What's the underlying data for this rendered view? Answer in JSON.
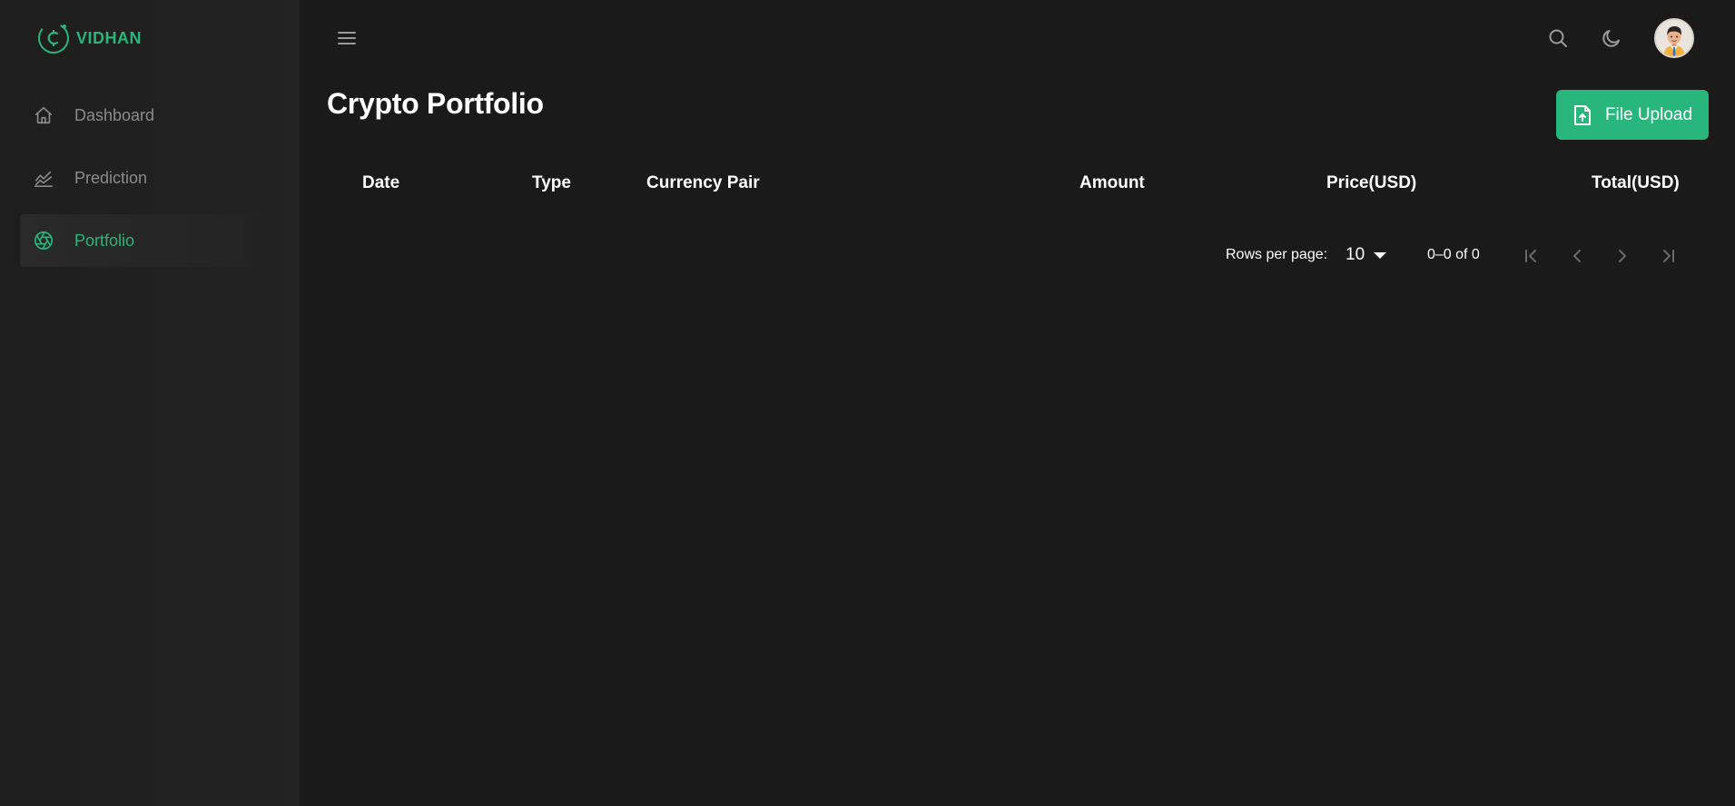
{
  "brand": {
    "name": "VIDHAN",
    "accent": "#28b67c"
  },
  "sidebar": {
    "items": [
      {
        "label": "Dashboard",
        "icon": "home-icon",
        "active": false
      },
      {
        "label": "Prediction",
        "icon": "chart-icon",
        "active": false
      },
      {
        "label": "Portfolio",
        "icon": "aperture-icon",
        "active": true
      }
    ]
  },
  "topbar": {
    "icons": [
      "menu-icon",
      "search-icon",
      "moon-icon",
      "avatar"
    ]
  },
  "main": {
    "title": "Crypto Portfolio",
    "upload_label": "File Upload",
    "columns": [
      "Date",
      "Type",
      "Currency Pair",
      "Amount",
      "Price(USD)",
      "Total(USD)"
    ],
    "rows": []
  },
  "pagination": {
    "rows_per_page_label": "Rows per page:",
    "rows_per_page": "10",
    "range": "0–0 of 0"
  }
}
